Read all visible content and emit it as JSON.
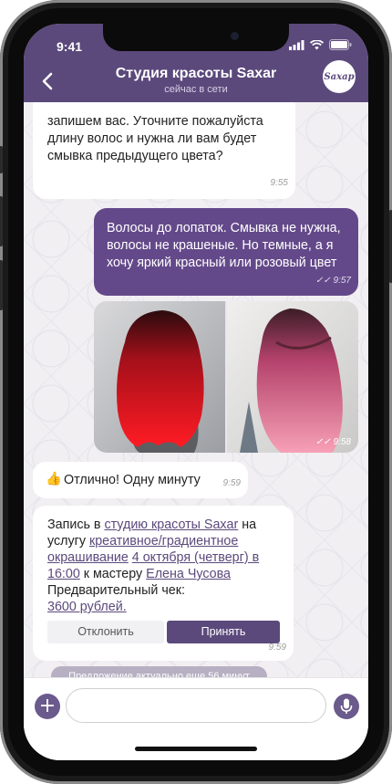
{
  "status_bar": {
    "time": "9:41"
  },
  "header": {
    "title": "Студия красоты Saxar",
    "subtitle": "сейчас в сети",
    "avatar_text": "Saxap"
  },
  "messages": {
    "m1": {
      "text": "запишем вас. Уточните пожалуйста длину волос и нужна ли вам будет смывка предыдущего цвета?",
      "time": "9:55"
    },
    "m2": {
      "text": "Волосы до лопаток. Смывка не нужна, волосы не крашеные. Но темные, а я хочу яркий красный или розовый цвет",
      "time": "9:57"
    },
    "m3": {
      "time": "9:58"
    },
    "m4": {
      "emoji": "👍",
      "text": "Отлично! Одну минуту",
      "time": "9:59"
    },
    "m5": {
      "p1": "Запись в ",
      "link1": "студию красоты Saxar",
      "p2": " на услугу ",
      "link2": "креативное/градиентное окрашивание",
      "p3": " ",
      "link3": "4 октября (четверг) в 16:00",
      "p4": " к мастеру ",
      "link4": "Елена Чусова",
      "p5": "Предварительный чек:",
      "link5": "3600 рублей.",
      "decline": "Отклонить",
      "accept": "Принять",
      "time": "9:59"
    }
  },
  "offer_notice": "Предложение актуально еще 56 минут",
  "input": {
    "placeholder": ""
  },
  "colors": {
    "brand": "#5b497c",
    "outgoing": "#64498a",
    "link": "#5b497c"
  }
}
